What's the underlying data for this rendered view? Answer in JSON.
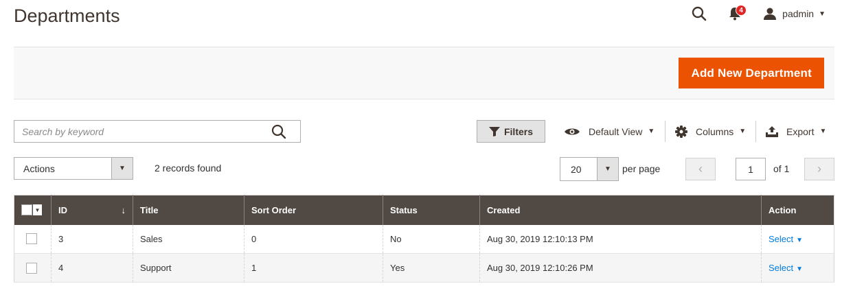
{
  "page": {
    "title": "Departments"
  },
  "header": {
    "notification_count": "4",
    "username": "padmin"
  },
  "page_actions": {
    "add_button": "Add New Department"
  },
  "toolbar": {
    "search_placeholder": "Search by keyword",
    "filters_label": "Filters",
    "view_label": "Default View",
    "columns_label": "Columns",
    "export_label": "Export",
    "actions_label": "Actions",
    "records_found": "2 records found",
    "per_page_value": "20",
    "per_page_label": "per page",
    "page_value": "1",
    "page_of": "of 1"
  },
  "grid": {
    "columns": [
      "ID",
      "Title",
      "Sort Order",
      "Status",
      "Created",
      "Action"
    ],
    "rows": [
      {
        "id": "3",
        "title": "Sales",
        "sort_order": "0",
        "status": "No",
        "created": "Aug 30, 2019 12:10:13 PM",
        "action": "Select"
      },
      {
        "id": "4",
        "title": "Support",
        "sort_order": "1",
        "status": "Yes",
        "created": "Aug 30, 2019 12:10:26 PM",
        "action": "Select"
      }
    ]
  },
  "colors": {
    "accent": "#eb5202",
    "grid_header": "#514943",
    "link": "#007bdb",
    "badge": "#e22626"
  },
  "icons": {
    "search": "search-icon",
    "bell": "bell-icon",
    "user": "user-icon",
    "filter": "filter-icon",
    "eye": "eye-icon",
    "gear": "gear-icon",
    "export": "export-icon"
  }
}
